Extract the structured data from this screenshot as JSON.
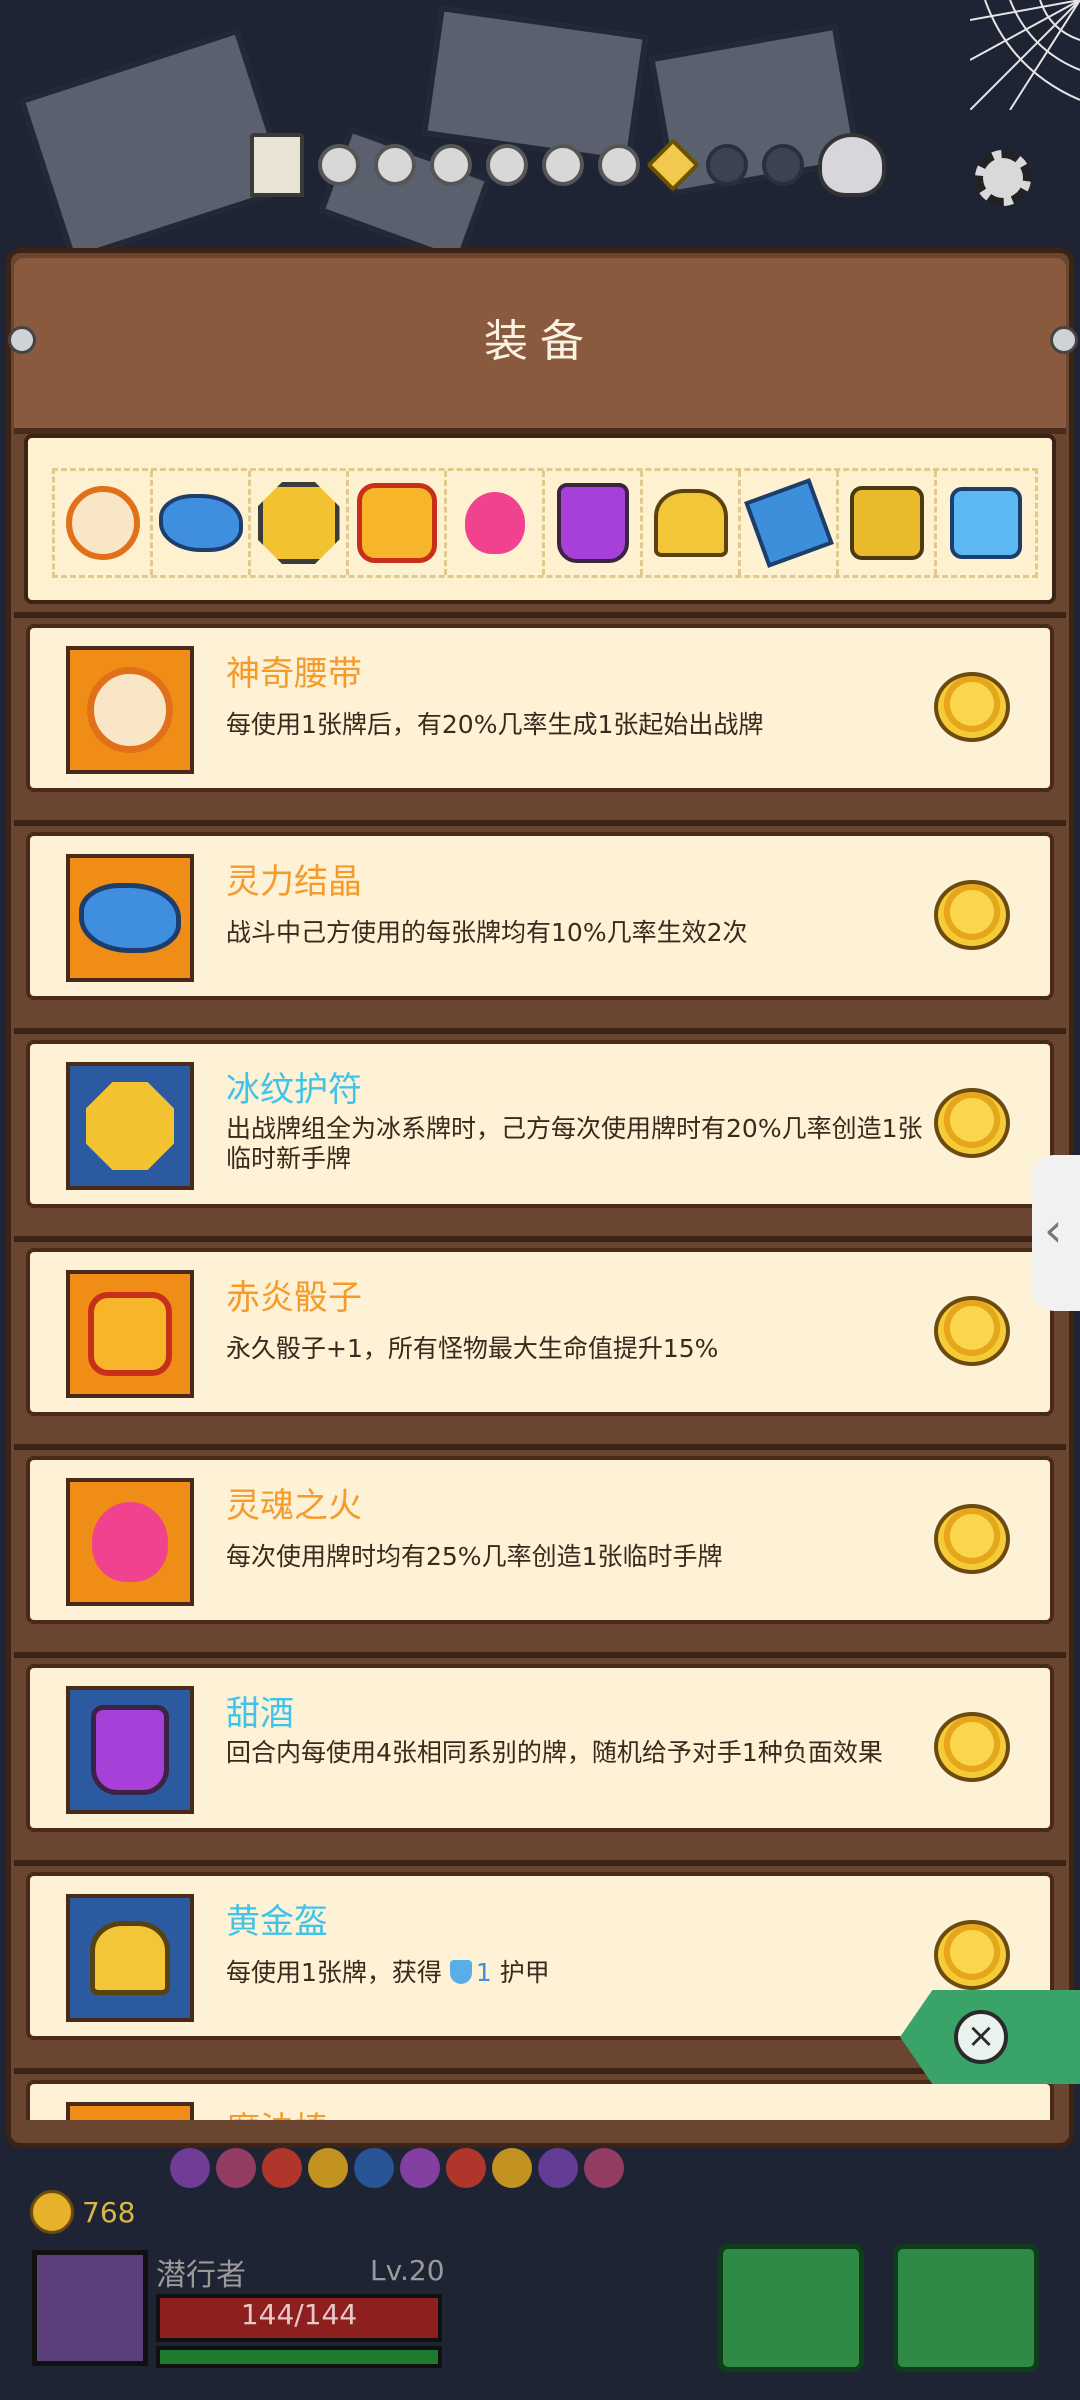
{
  "header": {
    "title": "装备"
  },
  "strip": {
    "icons": [
      "belt-icon",
      "crystal-icon",
      "amulet-icon",
      "fire-dice-icon",
      "soul-fire-icon",
      "wine-jug-icon",
      "golden-helmet-icon",
      "blue-shard-icon",
      "golden-eye-dice-icon",
      "ice-dice-icon"
    ]
  },
  "items": [
    {
      "name": "神奇腰带",
      "desc": "每使用1张牌后，有20%几率生成1张起始出战牌",
      "name_color": "orange",
      "frame": "orange",
      "icon": "belt-icon"
    },
    {
      "name": "灵力结晶",
      "desc": "战斗中己方使用的每张牌均有10%几率生效2次",
      "name_color": "orange",
      "frame": "orange",
      "icon": "crystal-icon"
    },
    {
      "name": "冰纹护符",
      "desc": "出战牌组全为冰系牌时，己方每次使用牌时有20%几率创造1张临时新手牌",
      "name_color": "cyan",
      "frame": "blue",
      "icon": "amulet-icon"
    },
    {
      "name": "赤炎骰子",
      "desc": "永久骰子+1，所有怪物最大生命值提升15%",
      "name_color": "orange",
      "frame": "orange",
      "icon": "fire-dice-icon"
    },
    {
      "name": "灵魂之火",
      "desc": "每次使用牌时均有25%几率创造1张临时手牌",
      "name_color": "orange",
      "frame": "orange",
      "icon": "soul-fire-icon"
    },
    {
      "name": "甜酒",
      "desc": "回合内每使用4张相同系别的牌，随机给予对手1种负面效果",
      "name_color": "cyan",
      "frame": "blue",
      "icon": "wine-jug-icon"
    },
    {
      "name": "黄金盔",
      "desc_prefix": "每使用1张牌，获得 ",
      "desc_value": "1",
      "desc_suffix": " 护甲",
      "name_color": "cyan",
      "frame": "blue",
      "icon": "golden-helmet-icon"
    }
  ],
  "partial_item": {
    "name": "魔法棒"
  },
  "player": {
    "name": "潜行者",
    "level": "Lv.20",
    "hp": "144/144",
    "gold": "768",
    "hp_fraction": 1.0
  },
  "colors": {
    "orange_frame": "#f08d16",
    "blue_frame": "#2b5aa0",
    "panel_wood": "#6a4530",
    "card_bg": "#fdf1d6"
  }
}
